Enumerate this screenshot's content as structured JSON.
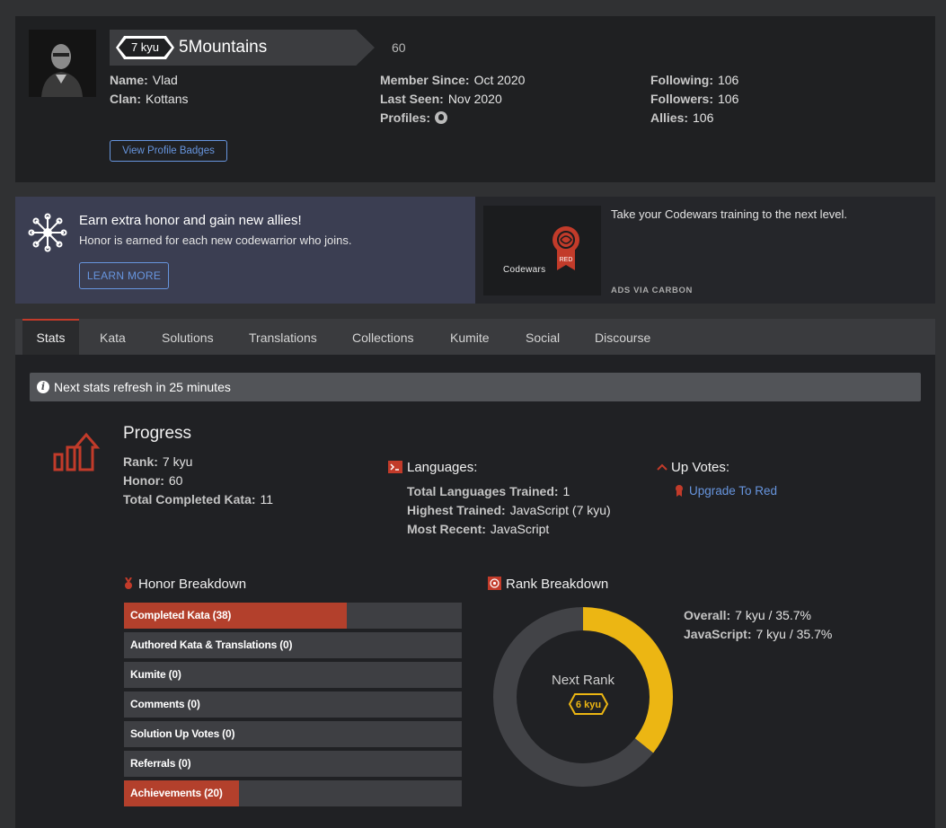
{
  "profile": {
    "rank": "7 kyu",
    "username": "5Mountains",
    "honor": "60",
    "left": [
      {
        "label": "Name:",
        "value": "Vlad"
      },
      {
        "label": "Clan:",
        "value": "Kottans"
      }
    ],
    "middle": [
      {
        "label": "Member Since:",
        "value": "Oct 2020"
      },
      {
        "label": "Last Seen:",
        "value": "Nov 2020"
      },
      {
        "label": "Profiles:",
        "value": ""
      }
    ],
    "right": [
      {
        "label": "Following:",
        "value": "106"
      },
      {
        "label": "Followers:",
        "value": "106"
      },
      {
        "label": "Allies:",
        "value": "106"
      }
    ],
    "badges_button": "View Profile Badges"
  },
  "promo": {
    "title": "Earn extra honor and gain new allies!",
    "subtitle": "Honor is earned for each new codewarrior who joins.",
    "button": "LEARN MORE"
  },
  "ad": {
    "brand": "Codewars",
    "badge": "RED",
    "text": "Take your Codewars training to the next level.",
    "via": "ADS VIA CARBON"
  },
  "tabs": [
    "Stats",
    "Kata",
    "Solutions",
    "Translations",
    "Collections",
    "Kumite",
    "Social",
    "Discourse"
  ],
  "notice": "Next stats refresh in 25 minutes",
  "progress": {
    "title": "Progress",
    "stats": [
      {
        "label": "Rank:",
        "value": "7 kyu"
      },
      {
        "label": "Honor:",
        "value": "60"
      },
      {
        "label": "Total Completed Kata:",
        "value": "11"
      }
    ]
  },
  "languages": {
    "title": "Languages:",
    "stats": [
      {
        "label": "Total Languages Trained:",
        "value": "1"
      },
      {
        "label": "Highest Trained:",
        "value": "JavaScript (7 kyu)"
      },
      {
        "label": "Most Recent:",
        "value": "JavaScript"
      }
    ]
  },
  "upvotes": {
    "title": "Up Votes:",
    "link": "Upgrade To Red"
  },
  "honor_breakdown": {
    "title": "Honor Breakdown",
    "items": [
      {
        "label": "Completed Kata (38)",
        "fraction": 0.66
      },
      {
        "label": "Authored Kata & Translations (0)",
        "fraction": 0
      },
      {
        "label": "Kumite (0)",
        "fraction": 0
      },
      {
        "label": "Comments (0)",
        "fraction": 0
      },
      {
        "label": "Solution Up Votes (0)",
        "fraction": 0
      },
      {
        "label": "Referrals (0)",
        "fraction": 0
      },
      {
        "label": "Achievements (20)",
        "fraction": 0.34
      }
    ]
  },
  "rank_breakdown": {
    "title": "Rank Breakdown",
    "center_label": "Next Rank",
    "next_rank": "6 kyu",
    "progress_percent": 35.7,
    "stats": [
      {
        "label": "Overall:",
        "value": "7 kyu / 35.7%"
      },
      {
        "label": "JavaScript:",
        "value": "7 kyu / 35.7%"
      }
    ]
  },
  "colors": {
    "accent": "#c23b2a",
    "link": "#6795de",
    "rank_ring": "#ecb613"
  }
}
